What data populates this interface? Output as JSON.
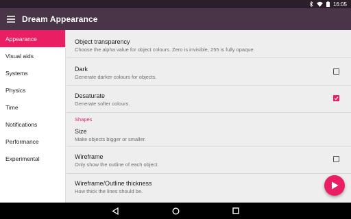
{
  "status_bar": {
    "time": "16:05",
    "icons": [
      "bluetooth-icon",
      "wifi-icon",
      "battery-icon"
    ]
  },
  "app_bar": {
    "title": "Dream Appearance",
    "menu_icon": "hamburger-menu-icon"
  },
  "sidebar": {
    "items": [
      {
        "label": "Appearance",
        "active": true
      },
      {
        "label": "Visual aids",
        "active": false
      },
      {
        "label": "Systems",
        "active": false
      },
      {
        "label": "Physics",
        "active": false
      },
      {
        "label": "Time",
        "active": false
      },
      {
        "label": "Notifications",
        "active": false
      },
      {
        "label": "Performance",
        "active": false
      },
      {
        "label": "Experimental",
        "active": false
      }
    ]
  },
  "preferences": {
    "object_transparency": {
      "title": "Object transparency",
      "summary": "Choose the alpha value for object colours. Zero is invisible, 255 is fully opaque."
    },
    "dark": {
      "title": "Dark",
      "summary": "Generate darker colours for objects.",
      "checked": false
    },
    "desaturate": {
      "title": "Desaturate",
      "summary": "Generate softer colours.",
      "checked": true
    },
    "shapes_header": "Shapes",
    "size": {
      "title": "Size",
      "summary": "Make objects bigger or smaller."
    },
    "wireframe": {
      "title": "Wireframe",
      "summary": "Only show the outline of each object.",
      "checked": false
    },
    "wireframe_thickness": {
      "title": "Wireframe/Outline thickness",
      "summary": "How thick the lines should be."
    }
  },
  "fab": {
    "icon": "play-icon"
  },
  "nav_bar": {
    "icons": [
      "back-icon",
      "home-icon",
      "recents-icon"
    ]
  },
  "colors": {
    "accent": "#e91e63",
    "app_bar": "#4a3447",
    "status_bar": "#2b1f2c"
  }
}
